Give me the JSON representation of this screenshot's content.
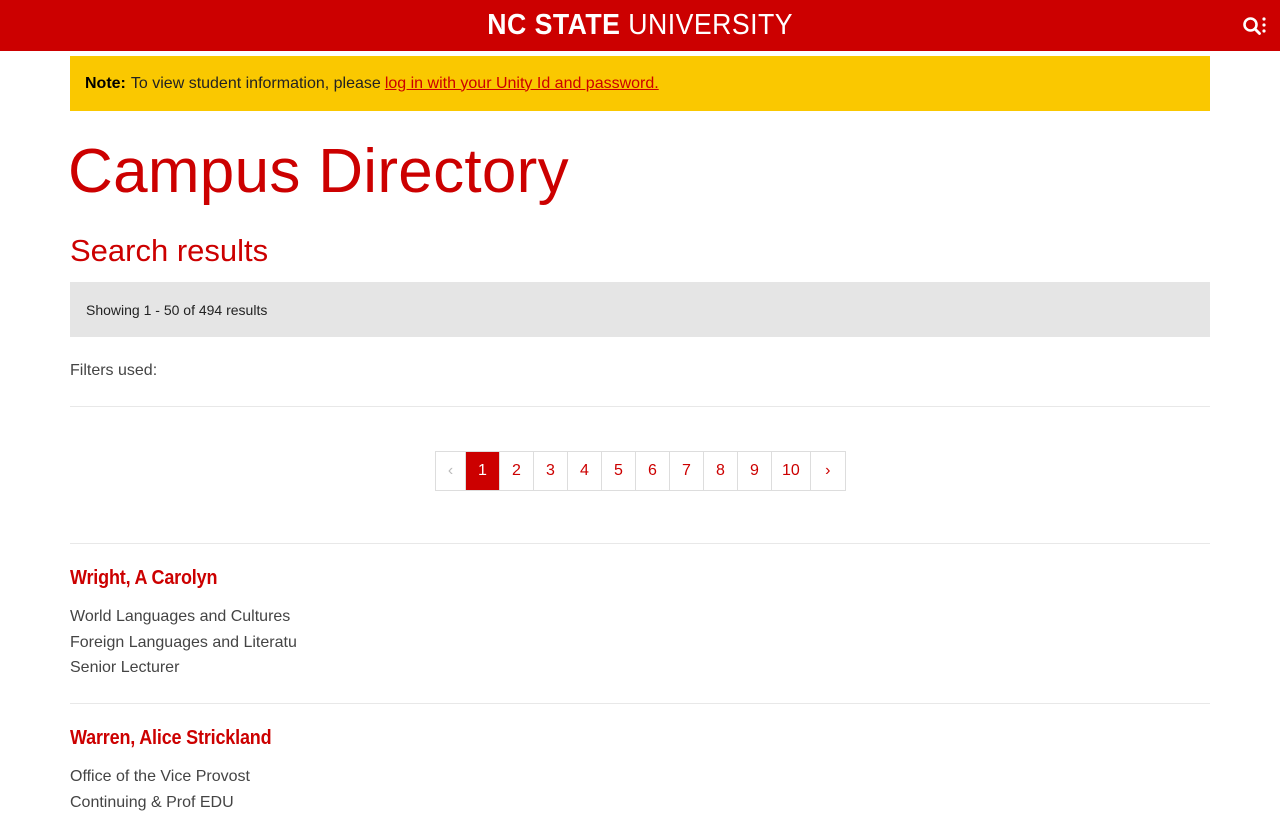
{
  "header": {
    "brand_bold": "NC STATE",
    "brand_thin": " UNIVERSITY",
    "search_icon": "search-icon"
  },
  "notice": {
    "label": "Note:",
    "text": "To view student information, please",
    "link": "log in with your Unity Id and password."
  },
  "page": {
    "title": "Campus Directory",
    "section_title": "Search results",
    "results_summary": "Showing 1 - 50 of 494 results",
    "filters_label": "Filters used:"
  },
  "pagination": {
    "prev": "‹",
    "pages": [
      "1",
      "2",
      "3",
      "4",
      "5",
      "6",
      "7",
      "8",
      "9",
      "10"
    ],
    "active": "1",
    "next": "›"
  },
  "people": [
    {
      "name": "Wright, A Carolyn",
      "lines": [
        "World Languages and Cultures",
        "Foreign Languages and Literatu",
        "Senior Lecturer"
      ]
    },
    {
      "name": "Warren, Alice Strickland",
      "lines": [
        "Office of the Vice Provost",
        "Continuing & Prof EDU"
      ]
    }
  ],
  "colors": {
    "brand_red": "#cc0000",
    "notice_yellow": "#fac800",
    "results_gray": "#e5e5e5"
  }
}
